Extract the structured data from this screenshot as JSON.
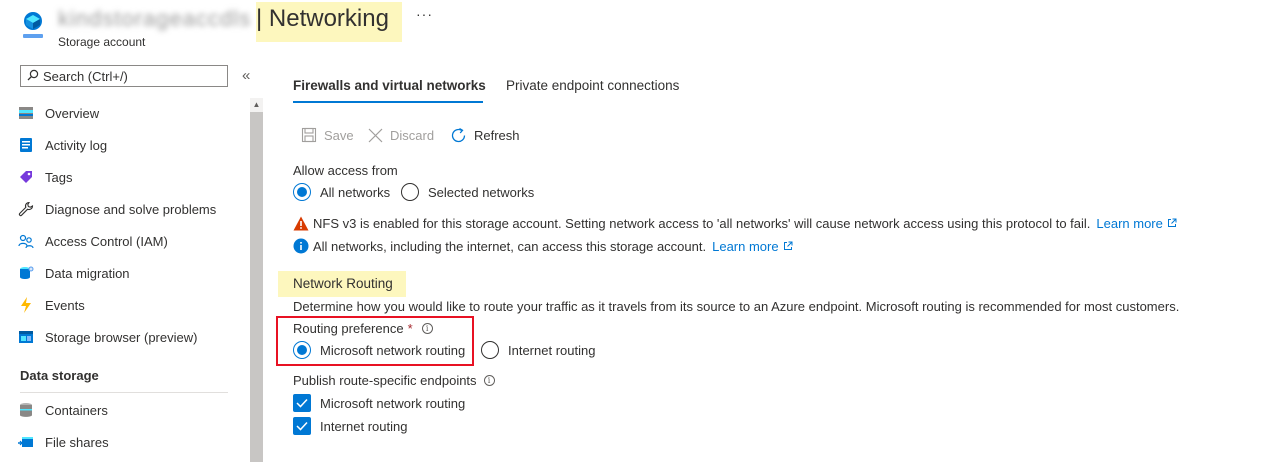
{
  "header": {
    "resource_name": "kindstorageaccdls",
    "title": "| Networking",
    "subtitle": "Storage account",
    "more": "···"
  },
  "sidebar": {
    "search_placeholder": "Search (Ctrl+/)",
    "collapse": "«",
    "items": [
      {
        "label": "Overview",
        "icon": "overview-icon"
      },
      {
        "label": "Activity log",
        "icon": "activity-log-icon"
      },
      {
        "label": "Tags",
        "icon": "tag-icon"
      },
      {
        "label": "Diagnose and solve problems",
        "icon": "wrench-icon"
      },
      {
        "label": "Access Control (IAM)",
        "icon": "people-icon"
      },
      {
        "label": "Data migration",
        "icon": "data-migration-icon"
      },
      {
        "label": "Events",
        "icon": "lightning-icon"
      },
      {
        "label": "Storage browser (preview)",
        "icon": "storage-browser-icon"
      }
    ],
    "section_title": "Data storage",
    "section_items": [
      {
        "label": "Containers",
        "icon": "containers-icon"
      },
      {
        "label": "File shares",
        "icon": "file-shares-icon"
      }
    ]
  },
  "tabs": [
    {
      "label": "Firewalls and virtual networks",
      "active": true
    },
    {
      "label": "Private endpoint connections",
      "active": false
    }
  ],
  "toolbar": {
    "save": "Save",
    "discard": "Discard",
    "refresh": "Refresh"
  },
  "access": {
    "label": "Allow access from",
    "options": [
      "All networks",
      "Selected networks"
    ],
    "selected": "All networks",
    "warning": "NFS v3 is enabled for this storage account. Setting network access to 'all networks' will cause network access using this protocol to fail.",
    "warning_link": "Learn more",
    "info": "All networks, including the internet, can access this storage account.",
    "info_link": "Learn more"
  },
  "routing": {
    "heading": "Network Routing",
    "description": "Determine how you would like to route your traffic as it travels from its source to an Azure endpoint. Microsoft routing is recommended for most customers.",
    "preference_label": "Routing preference",
    "required_mark": "*",
    "options": [
      "Microsoft network routing",
      "Internet routing"
    ],
    "selected": "Microsoft network routing",
    "publish_label": "Publish route-specific endpoints",
    "publish_options": [
      {
        "label": "Microsoft network routing",
        "checked": true
      },
      {
        "label": "Internet routing",
        "checked": true
      }
    ]
  },
  "colors": {
    "accent": "#0078d4",
    "highlight": "#fdf7be",
    "warning": "#d83b01",
    "callout": "#e81123"
  }
}
